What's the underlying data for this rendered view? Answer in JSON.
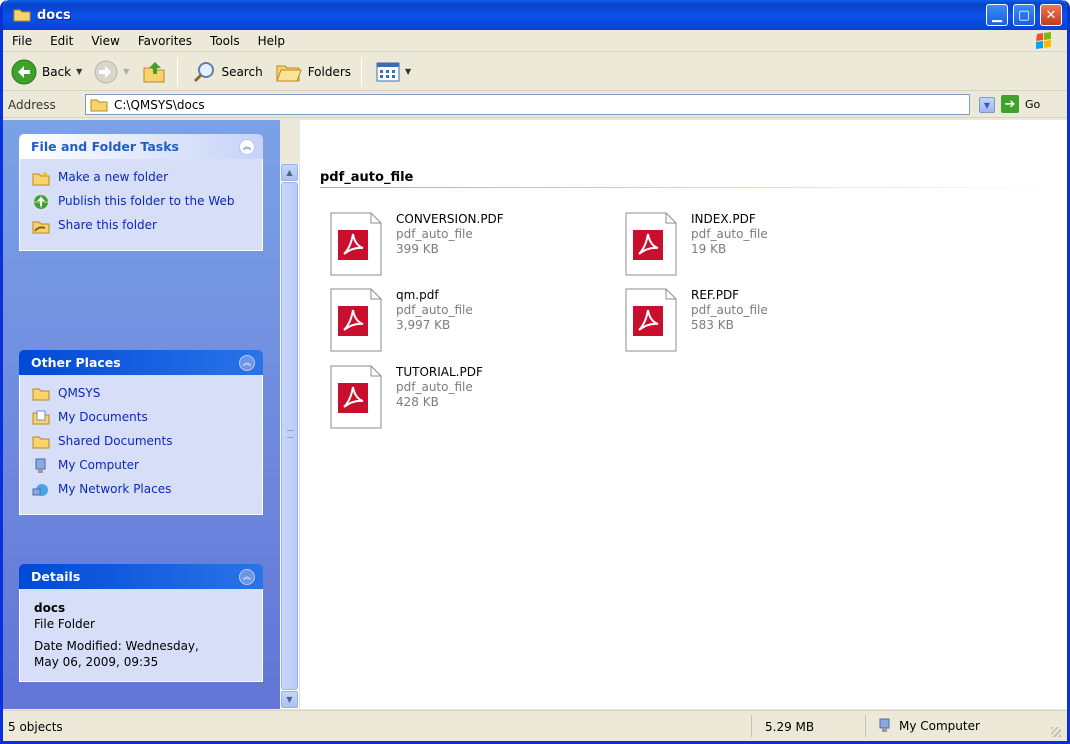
{
  "window": {
    "title": "docs",
    "controls": [
      "minimize",
      "maximize",
      "close"
    ]
  },
  "menu": [
    "File",
    "Edit",
    "View",
    "Favorites",
    "Tools",
    "Help"
  ],
  "toolbar": {
    "back_label": "Back",
    "search_label": "Search",
    "folders_label": "Folders"
  },
  "address": {
    "label": "Address",
    "value": "C:\\QMSYS\\docs",
    "go_label": "Go"
  },
  "tasks_panel": {
    "title": "File and Folder Tasks",
    "items": [
      {
        "label": "Make a new folder",
        "icon": "new-folder-icon"
      },
      {
        "label": "Publish this folder to the Web",
        "icon": "publish-web-icon"
      },
      {
        "label": "Share this folder",
        "icon": "share-folder-icon"
      }
    ]
  },
  "places_panel": {
    "title": "Other Places",
    "items": [
      {
        "label": "QMSYS",
        "icon": "folder-icon"
      },
      {
        "label": "My Documents",
        "icon": "my-documents-icon"
      },
      {
        "label": "Shared Documents",
        "icon": "folder-icon"
      },
      {
        "label": "My Computer",
        "icon": "my-computer-icon"
      },
      {
        "label": "My Network Places",
        "icon": "network-places-icon"
      }
    ]
  },
  "details_panel": {
    "title": "Details",
    "name": "docs",
    "type": "File Folder",
    "modified_line1": "Date Modified: Wednesday,",
    "modified_line2": "May 06, 2009, 09:35"
  },
  "group": {
    "header": "pdf_auto_file"
  },
  "files": [
    {
      "name": "CONVERSION.PDF",
      "type": "pdf_auto_file",
      "size": "399 KB"
    },
    {
      "name": "INDEX.PDF",
      "type": "pdf_auto_file",
      "size": "19 KB"
    },
    {
      "name": "qm.pdf",
      "type": "pdf_auto_file",
      "size": "3,997 KB"
    },
    {
      "name": "REF.PDF",
      "type": "pdf_auto_file",
      "size": "583 KB"
    },
    {
      "name": "TUTORIAL.PDF",
      "type": "pdf_auto_file",
      "size": "428 KB"
    }
  ],
  "status": {
    "count": "5 objects",
    "size": "5.29 MB",
    "zone": "My Computer"
  },
  "colors": {
    "titlebar": "#0a53e6",
    "task_pane": "#7ba2e7",
    "link": "#0c29b6",
    "pdf_red": "#c8102e"
  }
}
